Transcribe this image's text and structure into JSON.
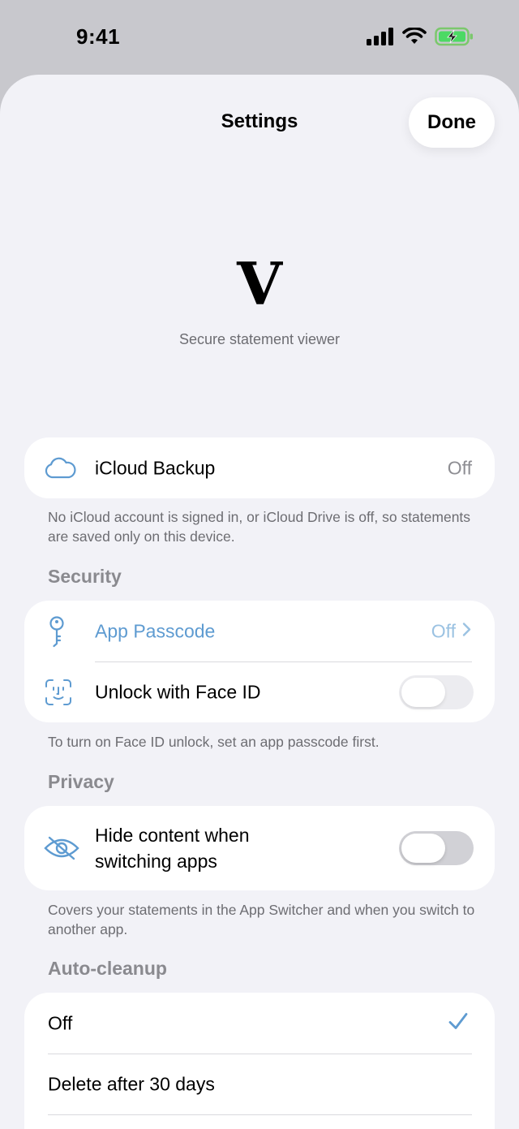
{
  "status_bar": {
    "time": "9:41"
  },
  "nav": {
    "title": "Settings",
    "done_label": "Done"
  },
  "brand": {
    "logo_letter": "V",
    "tagline": "Secure statement viewer"
  },
  "icloud": {
    "label": "iCloud Backup",
    "value": "Off",
    "icon": "cloud-icon",
    "footnote": "No iCloud account is signed in, or iCloud Drive is off, so statements are saved only on this device."
  },
  "security": {
    "header": "Security",
    "passcode": {
      "label": "App Passcode",
      "value": "Off",
      "icon": "key-icon"
    },
    "face_id": {
      "label": "Unlock with Face ID",
      "icon": "face-id-icon",
      "enabled": false
    },
    "footnote": "To turn on Face ID unlock, set an app passcode first."
  },
  "privacy": {
    "header": "Privacy",
    "hide_content": {
      "label_line1": "Hide content when",
      "label_line2": "switching apps",
      "icon": "eye-slash-icon",
      "enabled": false
    },
    "footnote": "Covers your statements in the App Switcher and when you switch to another app."
  },
  "auto_cleanup": {
    "header": "Auto-cleanup",
    "options": [
      {
        "label": "Off",
        "selected": true
      },
      {
        "label": "Delete after 30 days",
        "selected": false
      }
    ]
  },
  "colors": {
    "accent": "#5e9bd1",
    "background": "#f2f2f7",
    "card": "#ffffff",
    "secondary_text": "#6d6d72"
  }
}
